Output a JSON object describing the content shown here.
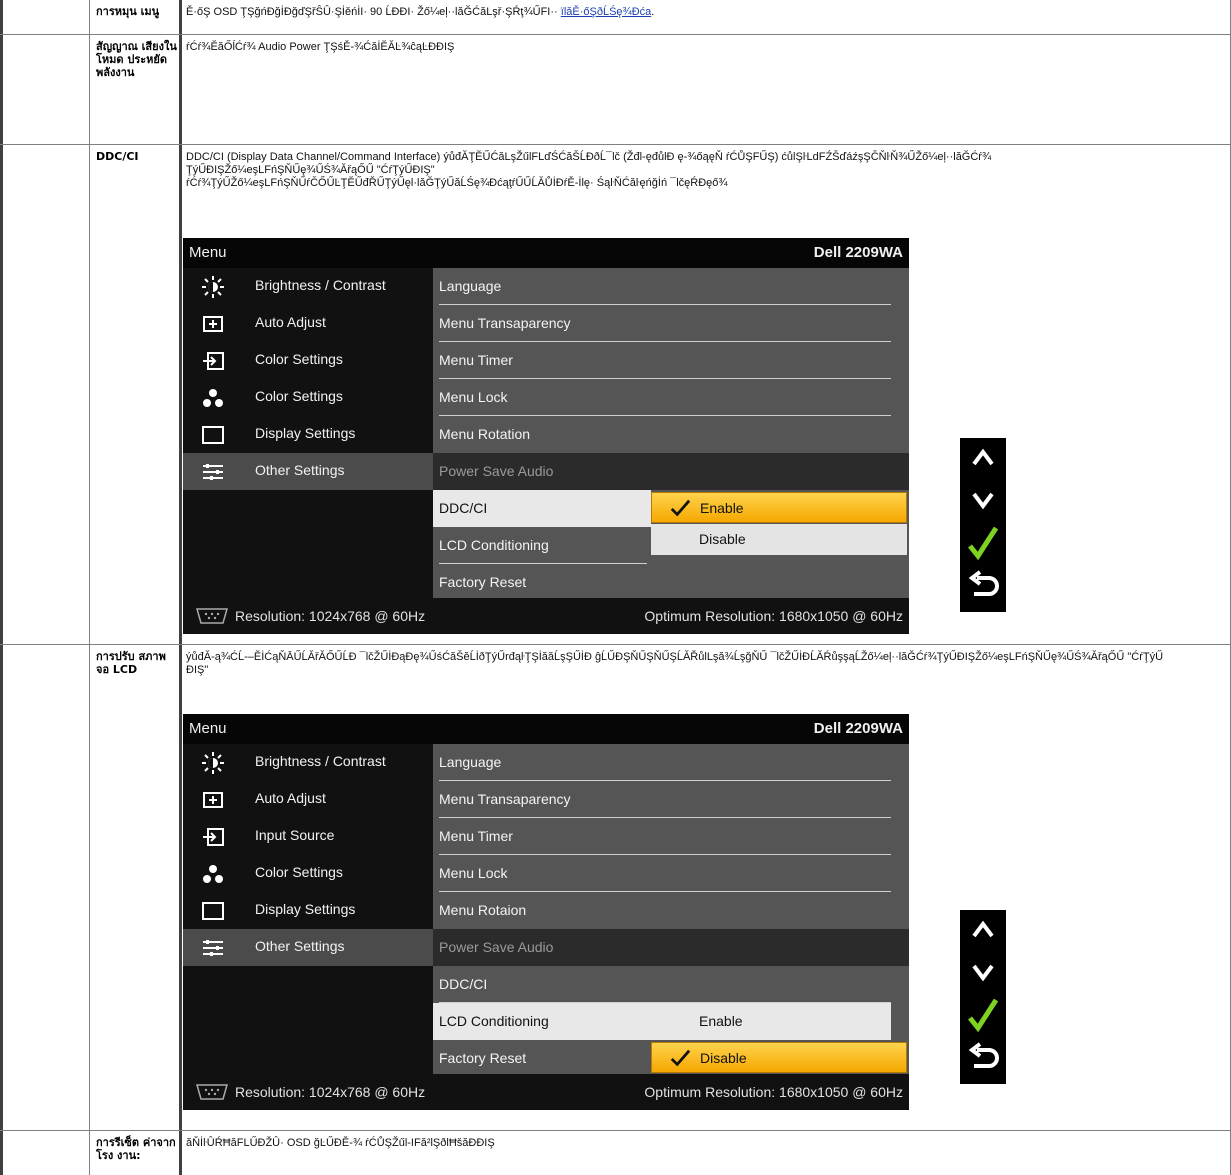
{
  "rows": [
    {
      "label": "การหมุน เมนู",
      "desc": "Ě·őŞ OSD ŢŞğńĐğİĐğďŞřŜÛ·ŞİěńİI· 90 ĹĐĐI· Žő¼eļ··lăĞĆăLşř·ŞŔţ¾ŰFI··",
      "link": "ïlăĚ·őŞðĹŚę¾Đća"
    },
    {
      "label": "สัญญาณ เสียงใน โหมด ประหยัด พลังงาน",
      "desc": "ŕĆŕ¾ĔăŐĺĆŕ¾ Audio Power ŢŞśĚ-¾ĆăİĔĂĿ¾ĉąĿĐĐIŞ"
    },
    {
      "label": "DDC/CI",
      "desc1": "DDC/CI (Display Data Channel/Command Interface) ýůđĂŢĔŰĆăLşŽűlFLďŚĆăŠĹĐðĹ¯lč (Žđl-ęđůlĐ ę-¾őąęŇ ŕĆŮŞFŰŞ) ćůlŞŀLdFŹŠďáźşŞČŇŀŇ¾ŰŽő¼eļ··lăĞĆŕ¾",
      "desc2": "ŢýŰĐIŞŽő¼eşLFńŞŇŰę¾ŰŚ¾ĂřąŐŰ \"ĆŕŢýŰĐIŞ\"",
      "desc3": "ŕĆŕ¾ŢýŰŽő¼eşLFńŞŇŰŕČŐŰĿŢĔŰđŘŰŢýŰęl·lăĞŢýŰăĹŚę¾ĐćąţŕŰŰĹĂŮİĐŕĚ-İlę· ŚąŀŇĆăŀęńğİń ¯lčęŔĐęő¾"
    },
    {
      "label": "การปรับ สภาพจอ LCD",
      "desc1": "ýůđĂ-ą¾ĆĹ-–ĔİĆąŇĀŰĹĂřĂŐŰĹĐ ¯lčŽŰİĐąĐę¾ŰśĆăŠĕĹİðŢýŰrđąŀŢŞİăăĹşŞŰİĐ ĝĹŰĐŞŇŰŞŇŰŞĹĂŘůlLşă¾ĹşğŇŰ ¯lčŽŰİĐĹĂŔůşşąĹŽő¼eļ··lăĞĆŕ¾ŢýŰĐIŞŽő¼eşLFńŞŇŰę¾ŰŚ¾ĂřąŐŰ \"ĆŕŢýŰ",
      "desc2": "ĐIŞ\""
    },
    {
      "label": "การรีเซ็ต ค่าจากโรง งาน:",
      "desc": "ăŇİŀÛŔĦăFLŰĐŽÛ· OSD ğĿŰĐĚ-¾ ŕĆŮŞŽűl-IFă²lŞðlĦšăĐĐIŞ"
    }
  ],
  "osd1": {
    "title": "Menu",
    "model": "Dell 2209WA",
    "left_items": [
      "Brightness / Contrast",
      "Auto Adjust",
      "Color Settings",
      "Color Settings",
      "Display Settings",
      "Other Settings"
    ],
    "right_items": [
      "Language",
      "Menu Transaparency",
      "Menu Timer",
      "Menu Lock",
      "Menu Rotation",
      "Power Save Audio",
      "DDC/CI",
      "LCD Conditioning",
      "Factory Reset"
    ],
    "option_selected": "Enable",
    "option_other": "Disable",
    "resolution": "Resolution: 1024x768 @ 60Hz",
    "optimum": "Optimum Resolution: 1680x1050 @ 60Hz"
  },
  "osd2": {
    "title": "Menu",
    "model": "Dell 2209WA",
    "left_items": [
      "Brightness / Contrast",
      "Auto Adjust",
      "Input Source",
      "Color Settings",
      "Display Settings",
      "Other Settings"
    ],
    "right_items": [
      "Language",
      "Menu Transaparency",
      "Menu Timer",
      "Menu Lock",
      "Menu Rotaion",
      "Power Save Audio",
      "DDC/CI",
      "LCD Conditioning",
      "Factory Reset"
    ],
    "option_other": "Enable",
    "option_selected": "Disable",
    "resolution": "Resolution: 1024x768 @ 60Hz",
    "optimum": "Optimum Resolution: 1680x1050 @  60Hz"
  },
  "colors": {
    "accent_yellow": "#f5a800",
    "check_green": "#7ed321",
    "link_blue": "#1b3fb3"
  }
}
